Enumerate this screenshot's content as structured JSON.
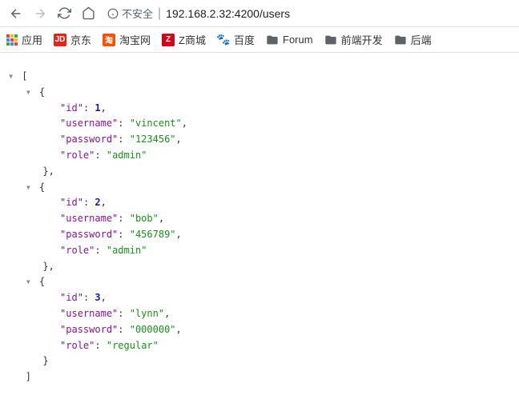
{
  "toolbar": {
    "insecure_label": "不安全",
    "url": "192.168.2.32:4200/users"
  },
  "bookmarks": {
    "apps": "应用",
    "items": [
      {
        "icon": "JD",
        "label": "京东"
      },
      {
        "icon": "淘",
        "label": "淘宝网"
      },
      {
        "icon": "Z",
        "label": "Z商城"
      },
      {
        "icon": "paw",
        "label": "百度"
      },
      {
        "icon": "folder",
        "label": "Forum"
      },
      {
        "icon": "folder",
        "label": "前端开发"
      },
      {
        "icon": "folder",
        "label": "后端"
      }
    ]
  },
  "json": {
    "keys": {
      "id": "id",
      "username": "username",
      "password": "password",
      "role": "role"
    },
    "users": [
      {
        "id": 1,
        "username": "vincent",
        "password": "123456",
        "role": "admin"
      },
      {
        "id": 2,
        "username": "bob",
        "password": "456789",
        "role": "admin"
      },
      {
        "id": 3,
        "username": "lynn",
        "password": "000000",
        "role": "regular"
      }
    ]
  }
}
